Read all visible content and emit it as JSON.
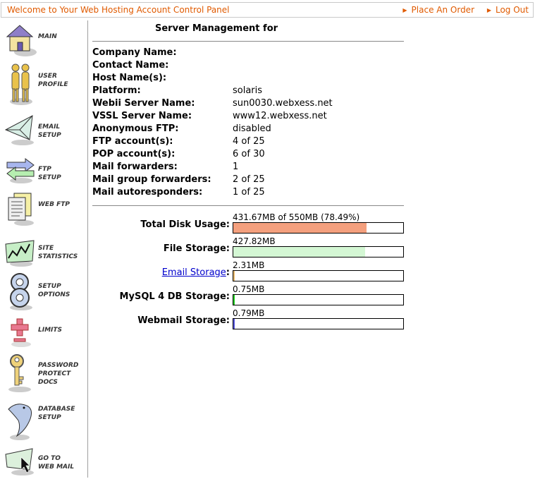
{
  "header": {
    "welcome": "Welcome to Your Web Hosting Account Control Panel",
    "place_order": "Place An Order",
    "log_out": "Log Out"
  },
  "sidebar": {
    "items": [
      {
        "label": "MAIN",
        "icon": "house-icon"
      },
      {
        "label": "USER\nPROFILE",
        "icon": "users-icon"
      },
      {
        "label": "EMAIL\nSETUP",
        "icon": "envelope-icon"
      },
      {
        "label": "FTP\nSETUP",
        "icon": "arrows-icon"
      },
      {
        "label": "WEB FTP",
        "icon": "documents-icon"
      },
      {
        "label": "SITE\nSTATISTICS",
        "icon": "stats-chart-icon"
      },
      {
        "label": "SETUP\nOPTIONS",
        "icon": "settings-icon"
      },
      {
        "label": "LIMITS",
        "icon": "plus-minus-icon"
      },
      {
        "label": "PASSWORD\nPROTECT\nDOCS",
        "icon": "key-icon"
      },
      {
        "label": "DATABASE\nSETUP",
        "icon": "dolphin-icon"
      },
      {
        "label": "GO TO\nWEB MAIL",
        "icon": "webmail-icon"
      }
    ]
  },
  "main": {
    "title": "Server Management for",
    "info": [
      {
        "key": "Company Name:",
        "value": ""
      },
      {
        "key": "Contact Name:",
        "value": ""
      },
      {
        "key": "Host Name(s):",
        "value": ""
      },
      {
        "key": "Platform:",
        "value": "solaris"
      },
      {
        "key": "Webii Server Name:",
        "value": "sun0030.webxess.net"
      },
      {
        "key": "VSSL Server Name:",
        "value": "www12.webxess.net"
      },
      {
        "key": "Anonymous FTP:",
        "value": "disabled"
      },
      {
        "key": "FTP account(s):",
        "value": "4 of 25"
      },
      {
        "key": "POP account(s):",
        "value": "6 of 30"
      },
      {
        "key": "Mail forwarders:",
        "value": "1"
      },
      {
        "key": "Mail group forwarders:",
        "value": "2 of 25"
      },
      {
        "key": "Mail autoresponders:",
        "value": "1 of 25"
      }
    ],
    "usage": [
      {
        "label": "Total Disk Usage:",
        "value": "431.67MB of 550MB (78.49%)",
        "percent": 78.49,
        "color": "#f4a07e",
        "link": false
      },
      {
        "label": "File Storage:",
        "value": "427.82MB",
        "percent": 77.8,
        "color": "#d4f7d4",
        "link": false
      },
      {
        "label": "Email Storage",
        "suffix": ":",
        "value": "2.31MB",
        "percent": 0.42,
        "color": "#e8b86a",
        "link": true
      },
      {
        "label": "MySQL 4 DB Storage:",
        "value": "0.75MB",
        "percent": 0.14,
        "color": "#22cc22",
        "link": false
      },
      {
        "label": "Webmail Storage:",
        "value": "0.79MB",
        "percent": 0.14,
        "color": "#5555dd",
        "link": false
      }
    ]
  }
}
